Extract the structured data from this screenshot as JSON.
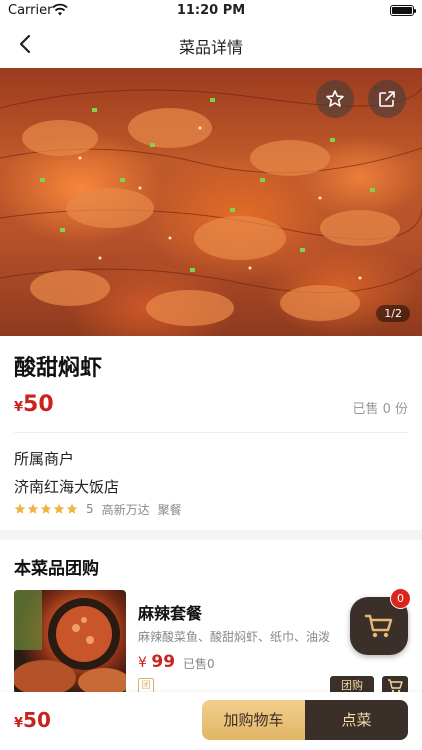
{
  "status_bar": {
    "carrier": "Carrier",
    "time": "11:20 PM"
  },
  "nav": {
    "title": "菜品详情"
  },
  "gallery": {
    "page_indicator": "1/2"
  },
  "dish": {
    "name": "酸甜焖虾",
    "currency": "¥",
    "price": "50",
    "sold_text": "已售 0 份"
  },
  "merchant": {
    "label": "所属商户",
    "name": "济南红海大饭店",
    "rating": 5,
    "rating_text": "5",
    "area": "高新万达",
    "category": "聚餐"
  },
  "group_buy": {
    "title": "本菜品团购",
    "item": {
      "name": "麻辣套餐",
      "desc": "麻辣酸菜鱼、酸甜焖虾、纸巾、油泼",
      "currency": "¥",
      "price": "99",
      "sold": "已售0",
      "tag": "团",
      "buy_label": "团购"
    }
  },
  "cart_badge": "0",
  "bottom": {
    "currency": "¥",
    "price": "50",
    "add_cart_label": "加购物车",
    "order_label": "点菜"
  },
  "colors": {
    "accent_red": "#c8231e",
    "dark_brown": "#3b2f29",
    "gold": "#e2b566"
  }
}
